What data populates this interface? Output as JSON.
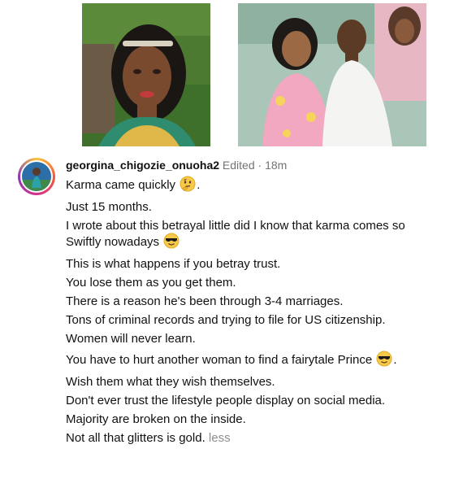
{
  "comment": {
    "username": "georgina_chigozie_onuoha2",
    "edited_label": "Edited",
    "separator": "·",
    "time_ago": "18m",
    "lines": [
      "Karma came quickly",
      "Just 15 months.",
      "I wrote about this betrayal little did I know that karma comes so Swiftly nowadays",
      "This is what happens if you betray trust.",
      "You lose them as you get them.",
      "There is a reason he's been through 3-4 marriages.",
      "Tons of criminal records and trying to file for US citizenship.",
      "Women will never learn.",
      "You have to hurt another woman to find a fairytale Prince",
      "Wish them what they wish themselves.",
      "Don't ever trust the lifestyle people display on social media.",
      "Majority are broken on the inside.",
      "Not all that glitters is gold."
    ],
    "less_label": "less",
    "emojis": [
      "thinking-face",
      "smiling-face-with-sunglasses"
    ]
  },
  "colors": {
    "avatar_ring": [
      "#f9c33a",
      "#f35b3f",
      "#d42f8c",
      "#8a3ab9"
    ],
    "meta_text": "#737373",
    "less_text": "#8e8e8e"
  }
}
